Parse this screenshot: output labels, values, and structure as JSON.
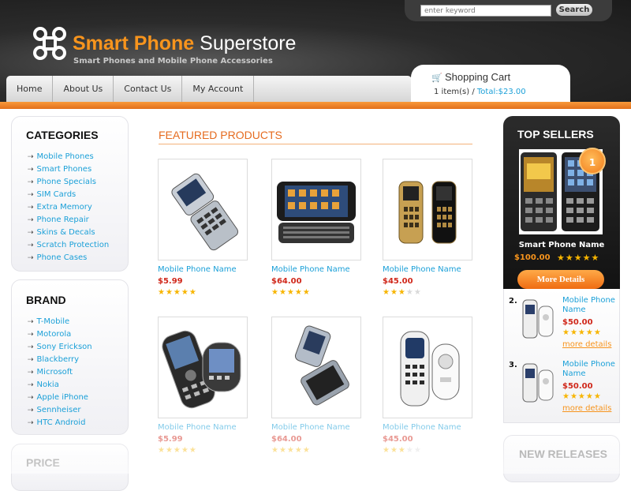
{
  "header": {
    "brand_bold": "Smart Phone",
    "brand_light": "Superstore",
    "tagline": "Smart Phones and Mobile Phone Accessories",
    "search_placeholder": "enter keyword",
    "search_button": "Search",
    "logo_icon": "command-key-icon"
  },
  "nav": [
    "Home",
    "About Us",
    "Contact Us",
    "My Account"
  ],
  "cart": {
    "title": "Shopping Cart",
    "items": "1 item(s) /",
    "total": "Total:$23.00",
    "icon": "cart-icon"
  },
  "categories": {
    "title": "CATEGORIES",
    "items": [
      "Mobile Phones",
      "Smart Phones",
      "Phone Specials",
      "SIM Cards",
      "Extra Memory",
      "Phone Repair",
      "Skins & Decals",
      "Scratch Protection",
      "Phone Cases"
    ]
  },
  "brand": {
    "title": "BRAND",
    "items": [
      "T-Mobile",
      "Motorola",
      "Sony Erickson",
      "Blackberry",
      "Microsoft",
      "Nokia",
      "Apple iPhone",
      "Sennheiser",
      "HTC Android"
    ]
  },
  "price_box": {
    "title": "PRICE"
  },
  "featured": {
    "title": "FEATURED PRODUCTS",
    "products": [
      {
        "name": "Mobile Phone Name",
        "price": "$5.99",
        "rating": 5
      },
      {
        "name": "Mobile Phone Name",
        "price": "$64.00",
        "rating": 5
      },
      {
        "name": "Mobile Phone Name",
        "price": "$45.00",
        "rating": 3
      },
      {
        "name": "Mobile Phone Name",
        "price": "$5.99",
        "rating": 5
      },
      {
        "name": "Mobile Phone Name",
        "price": "$64.00",
        "rating": 5
      },
      {
        "name": "Mobile Phone Name",
        "price": "$45.00",
        "rating": 3
      }
    ]
  },
  "top_sellers": {
    "title": "TOP SELLERS",
    "featured": {
      "rank": "1",
      "name": "Smart Phone Name",
      "price": "$100.00",
      "rating": 5,
      "button": "More Details"
    },
    "items": [
      {
        "rank": "2.",
        "name": "Mobile Phone Name",
        "price": "$50.00",
        "rating": 5,
        "link": "more details"
      },
      {
        "rank": "3.",
        "name": "Mobile Phone Name",
        "price": "$50.00",
        "rating": 5,
        "link": "more details"
      }
    ]
  },
  "new_releases": {
    "title": "NEW RELEASES"
  },
  "colors": {
    "accent": "#f7941d",
    "link": "#1ba0d8",
    "price": "#d0281b",
    "header_bg": "#2b2b2b"
  }
}
